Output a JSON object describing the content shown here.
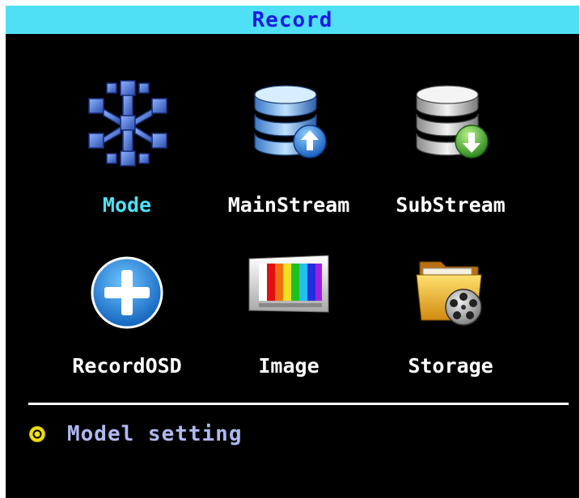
{
  "window": {
    "title": "Record"
  },
  "menu": {
    "items": [
      {
        "label": "Mode",
        "icon": "snowflake-cubes-icon",
        "selected": true
      },
      {
        "label": "MainStream",
        "icon": "database-upload-icon",
        "selected": false
      },
      {
        "label": "SubStream",
        "icon": "database-download-icon",
        "selected": false
      },
      {
        "label": "RecordOSD",
        "icon": "plus-circle-icon",
        "selected": false
      },
      {
        "label": "Image",
        "icon": "color-bars-monitor-icon",
        "selected": false
      },
      {
        "label": "Storage",
        "icon": "folder-film-reel-icon",
        "selected": false
      }
    ]
  },
  "status": {
    "text": "Model setting",
    "icon": "target-circle-icon"
  },
  "colors": {
    "title_bar": "#4fe0f5",
    "title_text": "#1a1ae6",
    "selected_label": "#4fe0f5",
    "label": "#ffffff",
    "status_text": "#b0b8f0",
    "background": "#000000"
  }
}
